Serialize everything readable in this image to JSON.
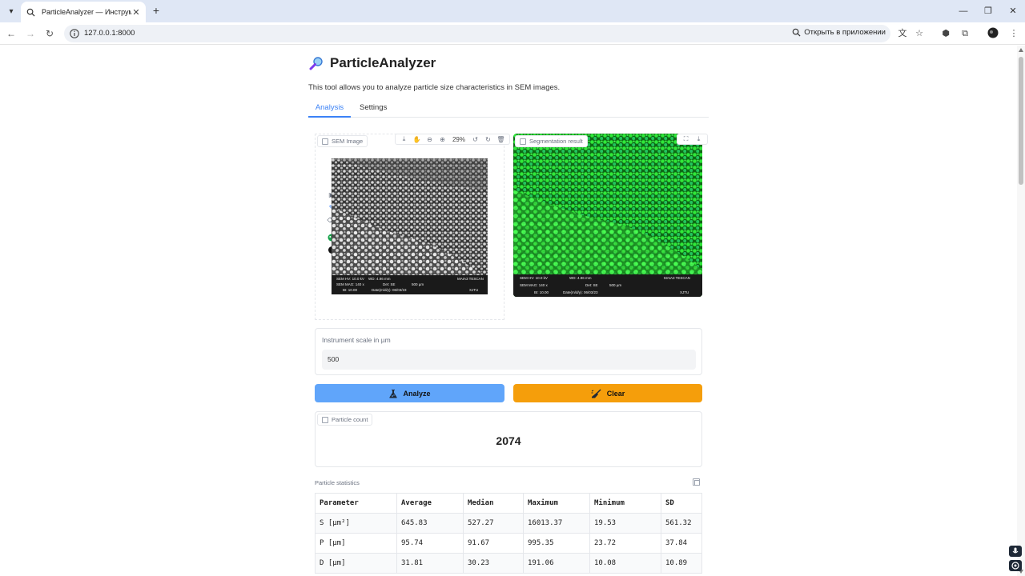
{
  "browser": {
    "tab_title": "ParticleAnalyzer — Инструмент",
    "url": "127.0.0.1:8000",
    "open_in_app": "Открыть в приложении"
  },
  "app": {
    "title": "ParticleAnalyzer",
    "description": "This tool allows you to analyze particle size characteristics in SEM images.",
    "tabs": [
      "Analysis",
      "Settings"
    ],
    "sem_image_label": "SEM Image",
    "zoom": "29%",
    "segmentation_label": "Segmentation result",
    "scale_label": "Instrument scale in µm",
    "scale_value": "500",
    "analyze_label": "Analyze",
    "clear_label": "Clear",
    "count_label": "Particle count",
    "count_value": "2074",
    "stats_label": "Particle statistics",
    "stats": {
      "headers": [
        "Parameter",
        "Average",
        "Median",
        "Maximum",
        "Minimum",
        "SD"
      ],
      "rows": [
        [
          "S [µm²]",
          "645.83",
          "527.27",
          "16013.37",
          "19.53",
          "561.32"
        ],
        [
          "P [µm]",
          "95.74",
          "91.67",
          "995.35",
          "23.72",
          "37.84"
        ],
        [
          "D [µm]",
          "31.81",
          "30.23",
          "191.06",
          "10.08",
          "10.89"
        ]
      ]
    }
  },
  "sem_info": {
    "left": {
      "hv": "SEM HV: 10.0 kV",
      "wd": "WD: 4.96 mm",
      "mag": "SEM MAG: 140 x",
      "det": "Det: SE",
      "scale": "500 µm",
      "bi": "BI: 10.00",
      "date": "Date(m/d/y): 06/03/23",
      "brand": "MAIA3 TESCAN",
      "org": "XJTU"
    },
    "right": {
      "hv": "SEM HV: 10.0 kV",
      "wd": "WD: 4.96 mm",
      "mag": "SEM MAG: 140 x",
      "det": "Det: SE",
      "scale": "500 µm",
      "bi": "BI: 10.00",
      "date": "Date(m/d/y): 06/03/23",
      "brand": "MAIA3 TESCAN",
      "org": "XJTU"
    }
  },
  "colors": {
    "accent": "#3b82f6",
    "analyze": "#60a5fa",
    "clear": "#f59e0b",
    "segmentation": "#22c55e"
  }
}
